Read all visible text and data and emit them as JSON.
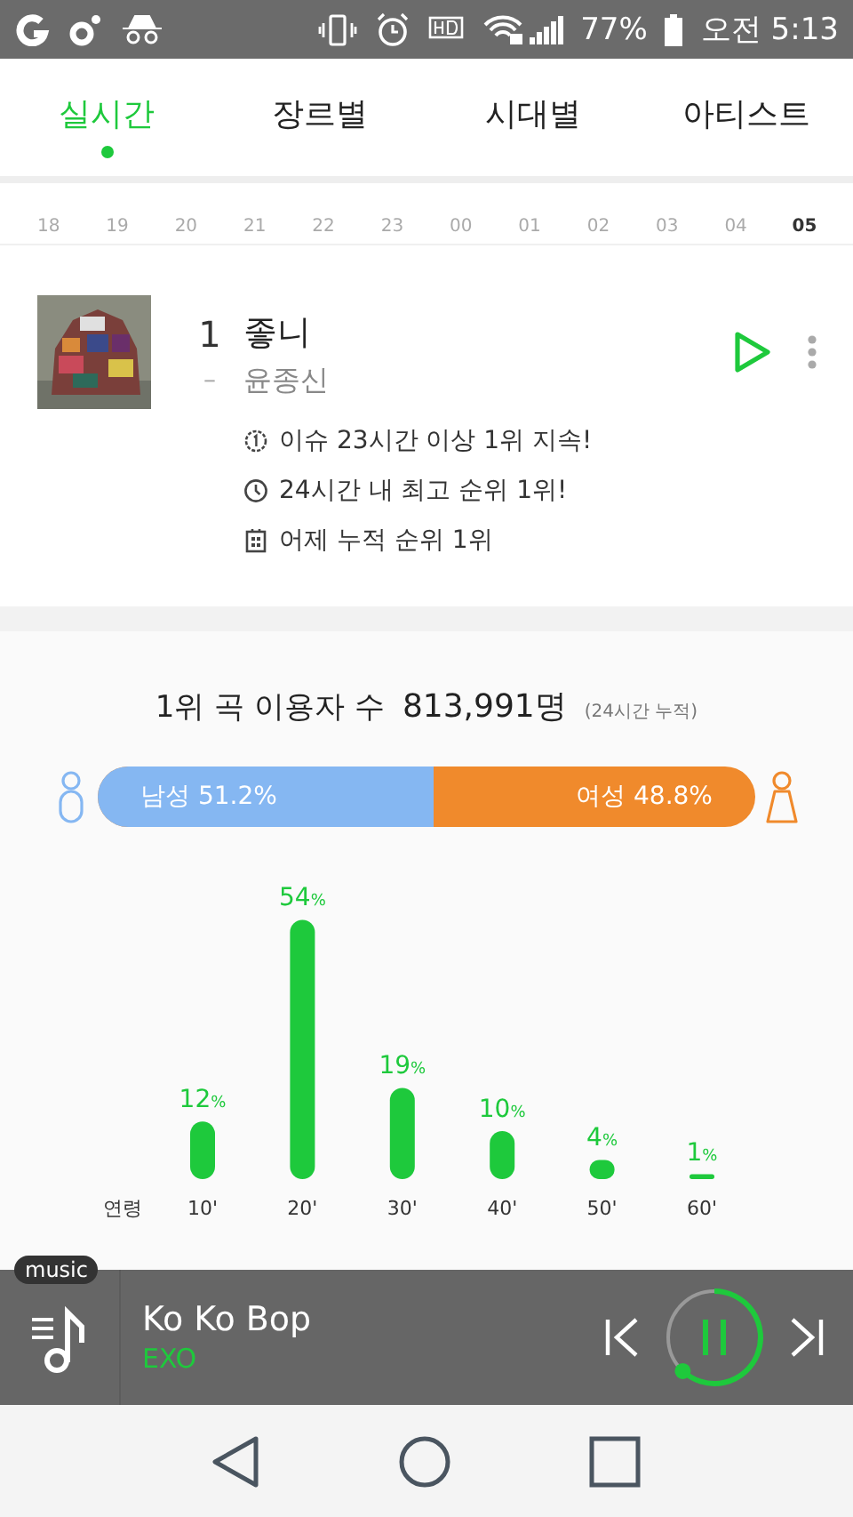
{
  "status_bar": {
    "battery": "77%",
    "time": "오전 5:13"
  },
  "tabs": [
    {
      "label": "실시간",
      "selected": true
    },
    {
      "label": "장르별",
      "selected": false
    },
    {
      "label": "시대별",
      "selected": false
    },
    {
      "label": "아티스트",
      "selected": false
    }
  ],
  "timeline": [
    {
      "label": "18",
      "selected": false
    },
    {
      "label": "19",
      "selected": false
    },
    {
      "label": "20",
      "selected": false
    },
    {
      "label": "21",
      "selected": false
    },
    {
      "label": "22",
      "selected": false
    },
    {
      "label": "23",
      "selected": false
    },
    {
      "label": "00",
      "selected": false
    },
    {
      "label": "01",
      "selected": false
    },
    {
      "label": "02",
      "selected": false
    },
    {
      "label": "03",
      "selected": false
    },
    {
      "label": "04",
      "selected": false
    },
    {
      "label": "05",
      "selected": true
    }
  ],
  "song": {
    "rank": "1",
    "change": "–",
    "title": "좋니",
    "artist": "윤종신",
    "facts": [
      {
        "kind": "issue",
        "text": "이슈 23시간 이상 1위 지속!"
      },
      {
        "kind": "clock",
        "text": "24시간 내 최고 순위 1위!"
      },
      {
        "kind": "calendar",
        "text": "어제 누적 순위 1위"
      }
    ]
  },
  "stats": {
    "label": "1위 곡 이용자 수",
    "count": "813,991명",
    "note": "(24시간 누적)",
    "male": {
      "label": "남성 51.2%",
      "level": 0.512
    },
    "female": {
      "label": "여성 48.8%"
    },
    "chart_data": {
      "type": "bar",
      "xlabel": "연령",
      "categories": [
        "10'",
        "20'",
        "30'",
        "40'",
        "50'",
        "60'"
      ],
      "values": [
        12,
        54,
        19,
        10,
        4,
        1
      ],
      "value_labels": [
        "12%",
        "54%",
        "19%",
        "10%",
        "4%",
        "1%"
      ]
    }
  },
  "player": {
    "badge": "music",
    "title": "Ko Ko Bop",
    "artist": "EXO"
  }
}
